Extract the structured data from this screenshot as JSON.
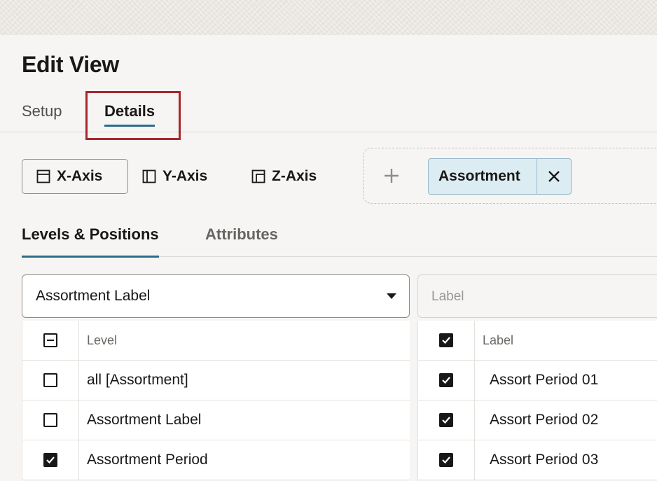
{
  "page": {
    "title": "Edit View"
  },
  "main_tabs": [
    {
      "label": "Setup",
      "selected": false
    },
    {
      "label": "Details",
      "selected": true
    }
  ],
  "axis_buttons": [
    {
      "label": "X-Axis",
      "icon": "x-axis-icon",
      "selected": true
    },
    {
      "label": "Y-Axis",
      "icon": "y-axis-icon",
      "selected": false
    },
    {
      "label": "Z-Axis",
      "icon": "z-axis-icon",
      "selected": false
    }
  ],
  "drop_zone": {
    "add_icon": "plus-icon",
    "chips": [
      {
        "label": "Assortment",
        "close_icon": "close-icon"
      }
    ]
  },
  "sub_tabs": [
    {
      "label": "Levels & Positions",
      "selected": true
    },
    {
      "label": "Attributes",
      "selected": false
    }
  ],
  "level_select": {
    "value": "Assortment Label"
  },
  "label_filter": {
    "placeholder": "Label"
  },
  "levels_table": {
    "header": {
      "label": "Level",
      "checkbox_state": "indeterminate"
    },
    "rows": [
      {
        "label": "all [Assortment]",
        "checked": false
      },
      {
        "label": "Assortment Label",
        "checked": false
      },
      {
        "label": "Assortment Period",
        "checked": true
      }
    ]
  },
  "labels_table": {
    "header": {
      "label": "Label",
      "checkbox_state": "checked"
    },
    "rows": [
      {
        "label": "Assort Period 01",
        "checked": true
      },
      {
        "label": "Assort Period 02",
        "checked": true
      },
      {
        "label": "Assort Period 03",
        "checked": true
      }
    ]
  },
  "colors": {
    "accent": "#2d6b8a",
    "highlight": "#a8262b",
    "chip_bg": "#dcecf3"
  }
}
